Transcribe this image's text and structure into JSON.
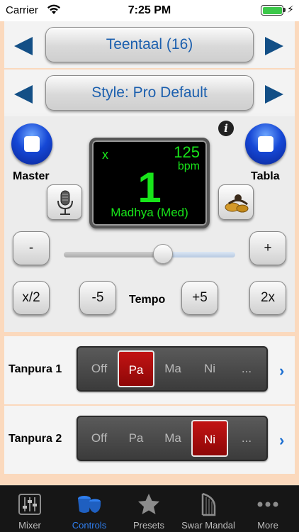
{
  "status_bar": {
    "carrier": "Carrier",
    "time": "7:25 PM"
  },
  "taal_selector": {
    "label": "Teentaal (16)"
  },
  "style_selector": {
    "label": "Style: Pro Default"
  },
  "master": {
    "label": "Master"
  },
  "tabla": {
    "label": "Tabla"
  },
  "display": {
    "marker": "x",
    "bpm_value": "125",
    "bpm_unit": "bpm",
    "beat": "1",
    "laya": "Madhya (Med)"
  },
  "tempo": {
    "minus_label": "-",
    "plus_label": "+",
    "half_label": "x/2",
    "minus5_label": "-5",
    "label": "Tempo",
    "plus5_label": "+5",
    "double_label": "2x",
    "slider_fraction": 0.58
  },
  "tanpura": [
    {
      "name": "Tanpura 1",
      "options": [
        "Off",
        "Pa",
        "Ma",
        "Ni",
        "..."
      ],
      "selected": "Pa"
    },
    {
      "name": "Tanpura 2",
      "options": [
        "Off",
        "Pa",
        "Ma",
        "Ni",
        "..."
      ],
      "selected": "Ni"
    }
  ],
  "tabs": [
    {
      "label": "Mixer",
      "icon": "mixer-icon"
    },
    {
      "label": "Controls",
      "icon": "tabla-drums-icon",
      "active": true
    },
    {
      "label": "Presets",
      "icon": "star-icon"
    },
    {
      "label": "Swar Mandal",
      "icon": "harp-icon"
    },
    {
      "label": "More",
      "icon": "more-dots-icon"
    }
  ],
  "colors": {
    "accent": "#134f86",
    "display_green": "#18e51a",
    "active_segment": "#b01010",
    "tab_active": "#2f7ff0",
    "background": "#fbd9bd"
  }
}
